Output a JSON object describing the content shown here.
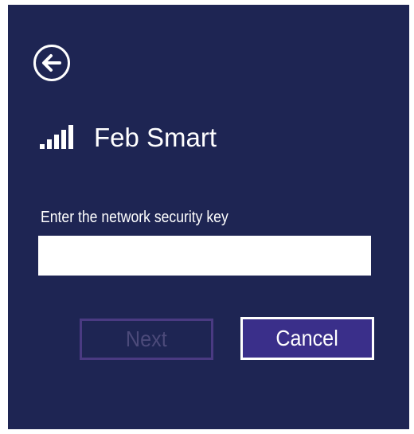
{
  "dialog": {
    "network_name": "Feb Smart",
    "key_label": "Enter the network security key",
    "key_value": "",
    "next_label": "Next",
    "cancel_label": "Cancel"
  },
  "icons": {
    "back": "back-arrow-icon",
    "signal": "wifi-signal-icon"
  },
  "colors": {
    "background": "#1e2553",
    "cancel_button": "#3a2f8a",
    "next_border": "#4a3a82"
  }
}
